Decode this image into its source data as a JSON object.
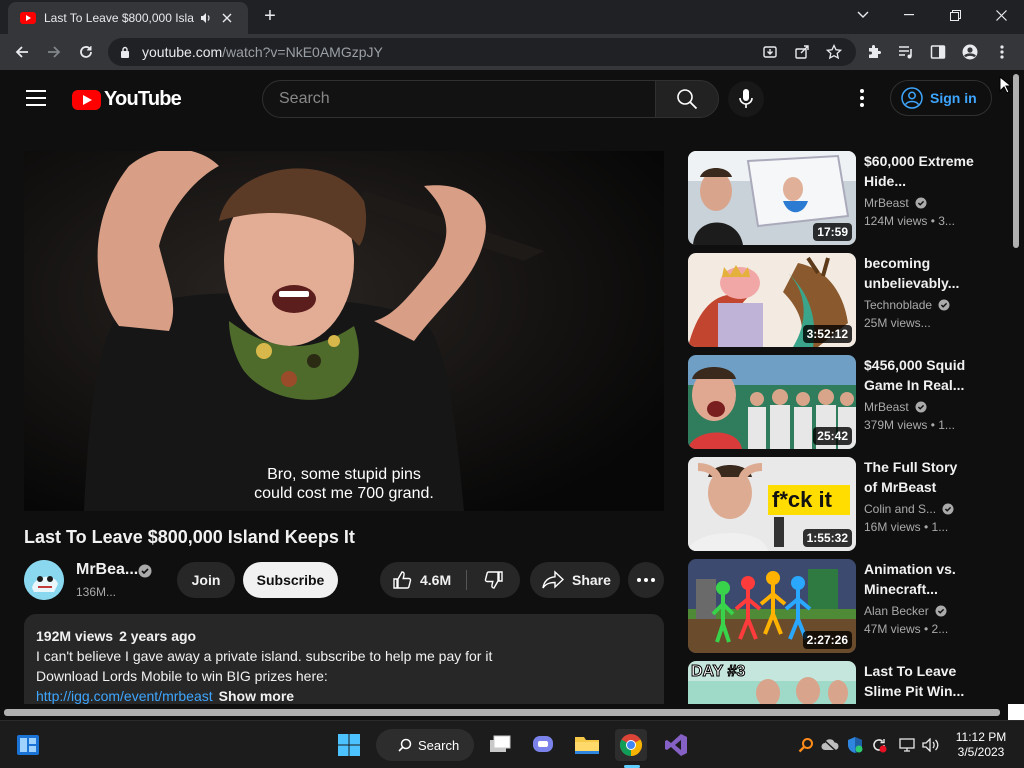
{
  "browser": {
    "tab": {
      "title": "Last To Leave $800,000 Island Keeps It",
      "audio_icon": "speaker-icon",
      "close_icon": "close-icon"
    },
    "new_tab_label": "+",
    "window_controls": [
      "chevron-down-icon",
      "minimize-icon",
      "restore-icon",
      "close-icon"
    ],
    "url_host": "youtube.com",
    "url_path": "/watch?v=NkE0AMGzpJY"
  },
  "youtube": {
    "logo_text": "YouTube",
    "search_placeholder": "Search",
    "sign_in_label": "Sign in",
    "video": {
      "title": "Last To Leave $800,000 Island Keeps It",
      "caption_line1": "Bro, some stupid pins",
      "caption_line2": "could cost me 700 grand.",
      "channel_name": "MrBea...",
      "channel_subs": "136M...",
      "join_label": "Join",
      "subscribe_label": "Subscribe",
      "likes": "4.6M",
      "share_label": "Share"
    },
    "description": {
      "views": "192M views",
      "age": "2 years ago",
      "line1": "I can't believe I gave away a private island. subscribe to help me pay for it",
      "line2": "Download Lords Mobile to win BIG prizes here:",
      "link": "http://igg.com/event/mrbeast",
      "show_more": "Show more"
    },
    "related": [
      {
        "title": "$60,000 Extreme Hide...",
        "channel": "MrBeast",
        "meta": "124M views • 3...",
        "duration": "17:59",
        "verified": true
      },
      {
        "title": "becoming unbelievably...",
        "channel": "Technoblade",
        "meta": "25M views...",
        "duration": "3:52:12",
        "verified": true
      },
      {
        "title": "$456,000 Squid Game In Real...",
        "channel": "MrBeast",
        "meta": "379M views • 1...",
        "duration": "25:42",
        "verified": true
      },
      {
        "title": "The Full Story of MrBeast",
        "channel": "Colin and S...",
        "meta": "16M views • 1...",
        "duration": "1:55:32",
        "verified": true,
        "thumb_text": "f*ck it"
      },
      {
        "title": "Animation vs. Minecraft...",
        "channel": "Alan Becker",
        "meta": "47M views • 2...",
        "duration": "2:27:26",
        "verified": true
      },
      {
        "title": "Last To Leave Slime Pit Win...",
        "channel": "",
        "meta": "",
        "duration": "",
        "verified": false,
        "thumb_text": "DAY #3"
      }
    ]
  },
  "taskbar": {
    "search_label": "Search",
    "time": "11:12 PM",
    "date": "3/5/2023",
    "apps": [
      "windows-start-icon",
      "task-view-icon",
      "teams-chat-icon",
      "file-explorer-icon",
      "chrome-icon",
      "visual-studio-icon"
    ]
  },
  "colors": {
    "youtube_red": "#ff0000",
    "link_blue": "#3ea6ff",
    "page_bg": "#0f0f0f",
    "chip_bg": "#272727"
  }
}
